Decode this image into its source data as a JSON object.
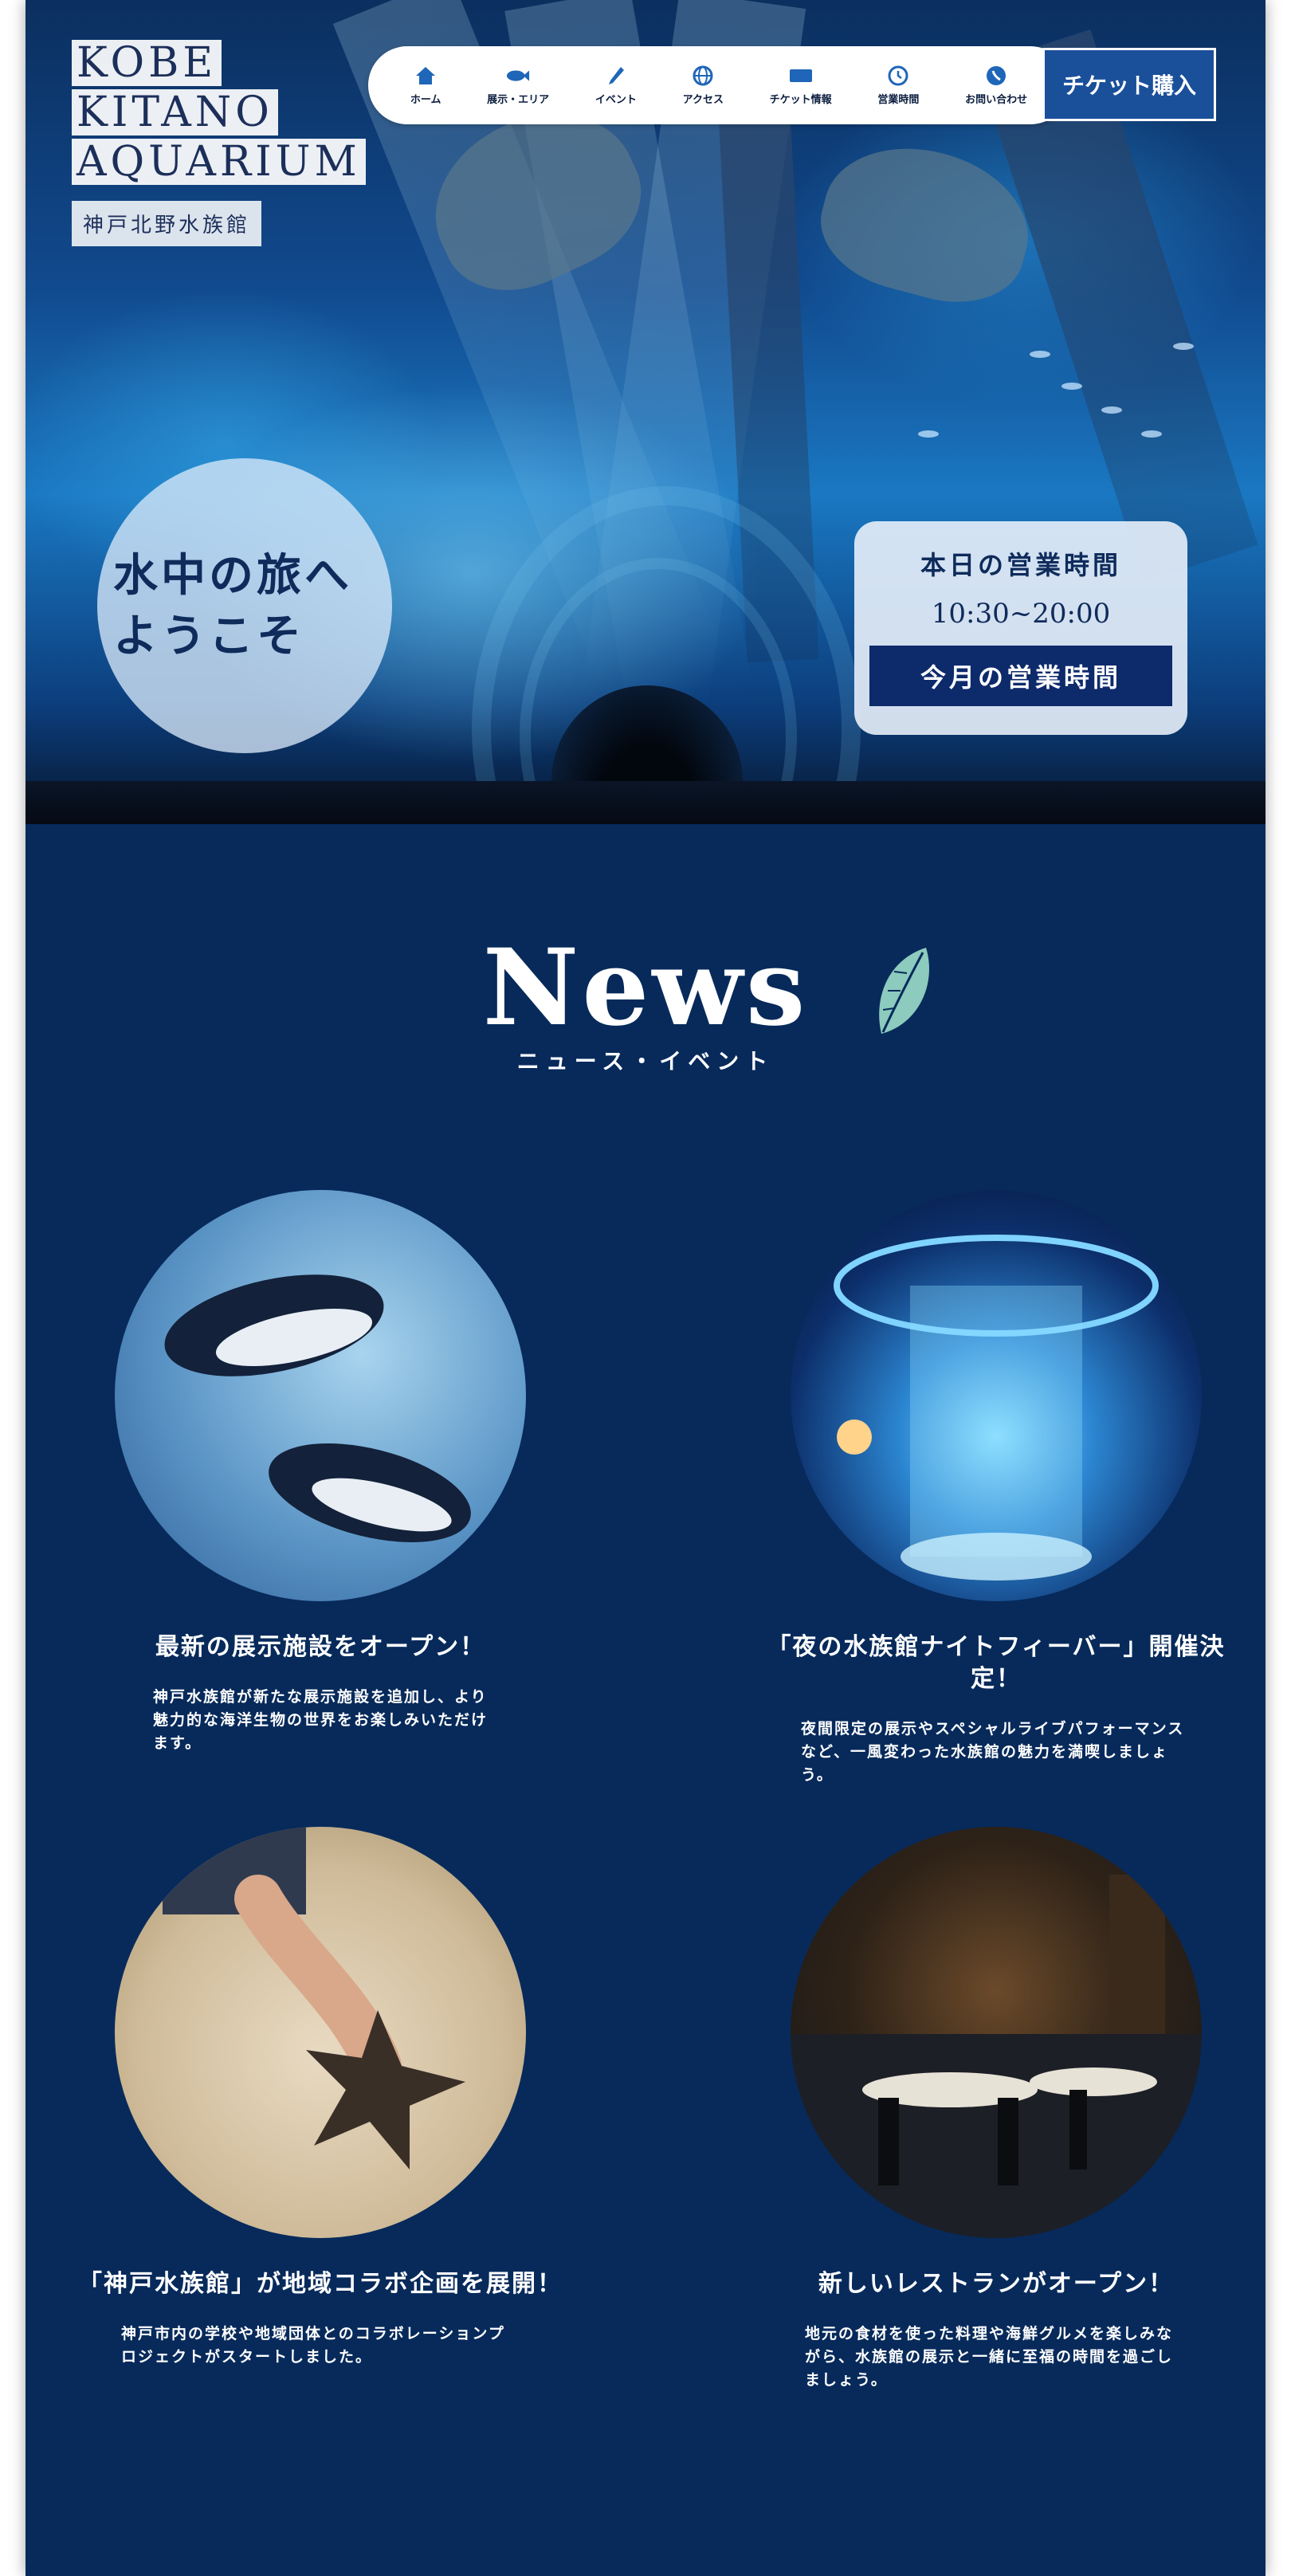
{
  "logo": {
    "line1": "KOBE",
    "line2": "KITANO",
    "line3": "AQUARIUM",
    "subtitle": "神戸北野水族館"
  },
  "nav": {
    "items": [
      {
        "label": "ホーム",
        "icon": "home-icon"
      },
      {
        "label": "展示・エリア",
        "icon": "fish-icon"
      },
      {
        "label": "イベント",
        "icon": "pen-icon"
      },
      {
        "label": "アクセス",
        "icon": "globe-icon"
      },
      {
        "label": "チケット情報",
        "icon": "ticket-icon"
      },
      {
        "label": "営業時間",
        "icon": "clock-icon"
      },
      {
        "label": "お問い合わせ",
        "icon": "phone-icon"
      }
    ],
    "ticket_button": "チケット購入"
  },
  "hero": {
    "welcome_line1": "水中の旅へ",
    "welcome_line2": "ようこそ"
  },
  "hours": {
    "title": "本日の営業時間",
    "time": "10:30~20:00",
    "button": "今月の営業時間"
  },
  "news": {
    "title": "News",
    "subtitle": "ニュース・イベント",
    "items": [
      {
        "title": "最新の展示施設をオープン！",
        "body": "神戸水族館が新たな展示施設を追加し、より魅力的な海洋生物の世界をお楽しみいただけます。"
      },
      {
        "title": "「夜の水族館ナイトフィーバー」開催決定！",
        "body": "夜間限定の展示やスペシャルライブパフォーマンスなど、一風変わった水族館の魅力を満喫しましょう。"
      },
      {
        "title": "「神戸水族館」が地域コラボ企画を展開！",
        "body": "神戸市内の学校や地域団体とのコラボレーションプロジェクトがスタートしました。"
      },
      {
        "title": "新しいレストランがオープン！",
        "body": "地元の食材を使った料理や海鮮グルメを楽しみながら、水族館の展示と一緒に至福の時間を過ごしましょう。"
      }
    ]
  },
  "colors": {
    "page_bg": "#072a5b",
    "accent": "#1a4f9a",
    "hours_button": "#0d2a6b",
    "leaf": "#8ccbbd"
  }
}
